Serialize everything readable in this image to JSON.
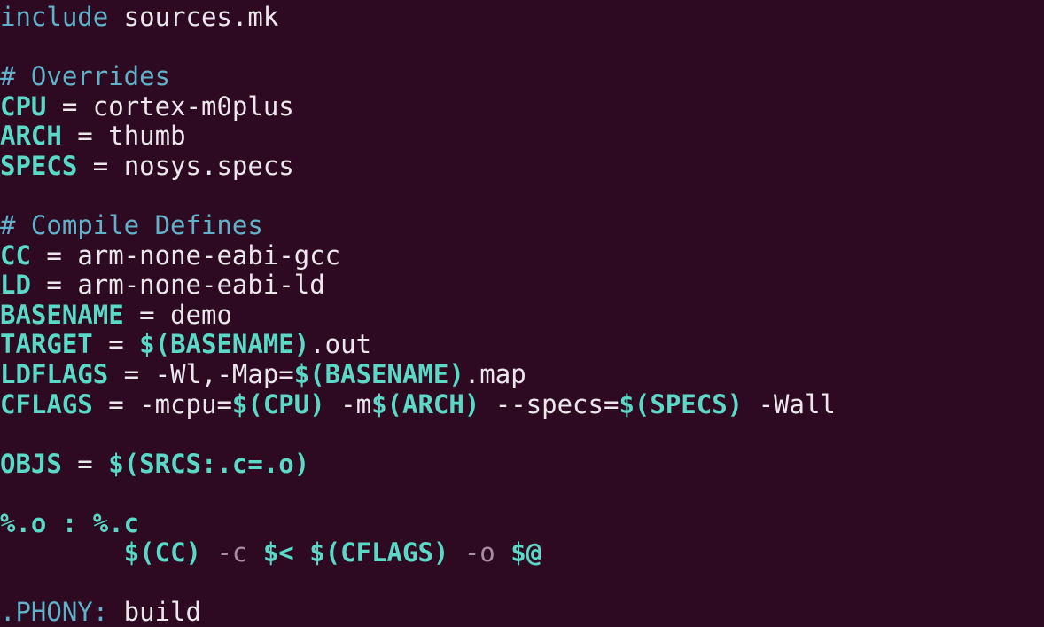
{
  "editor": {
    "colors": {
      "background": "#2d0a22",
      "comment": "#61b2c8",
      "variable": "#5ad9c6",
      "text": "#ece7ec",
      "dim_flag": "#a88da0"
    },
    "lines": {
      "l0": {
        "keyword": "include",
        "rest": " sources.mk"
      },
      "l2": {
        "comment": "# Overrides"
      },
      "l3": {
        "name": "CPU",
        "op": " = ",
        "value": "cortex-m0plus"
      },
      "l4": {
        "name": "ARCH",
        "op": " = ",
        "value": "thumb"
      },
      "l5": {
        "name": "SPECS",
        "op": " = ",
        "value": "nosys.specs"
      },
      "l7": {
        "comment": "# Compile Defines"
      },
      "l8": {
        "name": "CC",
        "op": " = ",
        "value": "arm-none-eabi-gcc"
      },
      "l9": {
        "name": "LD",
        "op": " = ",
        "value": "arm-none-eabi-ld"
      },
      "l10": {
        "name": "BASENAME",
        "op": " = ",
        "value": "demo"
      },
      "l11": {
        "name": "TARGET",
        "op": " = ",
        "ref": "$(BASENAME)",
        "value": ".out"
      },
      "l12": {
        "name": "LDFLAGS",
        "op": " = ",
        "pre": "-Wl,-Map=",
        "ref": "$(BASENAME)",
        "post": ".map"
      },
      "l13": {
        "name": "CFLAGS",
        "op": " = ",
        "p1": "-mcpu=",
        "r1": "$(CPU)",
        "p2": " -m",
        "r2": "$(ARCH)",
        "p3": " --specs=",
        "r3": "$(SPECS)",
        "p4": " -Wall"
      },
      "l15": {
        "name": "OBJS",
        "op": " = ",
        "ref": "$(SRCS:.c=.o)"
      },
      "l17": {
        "target": "%.o : %.c"
      },
      "l18": {
        "indent": "        ",
        "r1": "$(CC)",
        "f1": " -c ",
        "r2": "$<",
        "sp": " ",
        "r3": "$(CFLAGS)",
        "f2": " -o ",
        "r4": "$@"
      },
      "l20": {
        "target": ".PHONY:",
        "value": " build"
      }
    }
  }
}
